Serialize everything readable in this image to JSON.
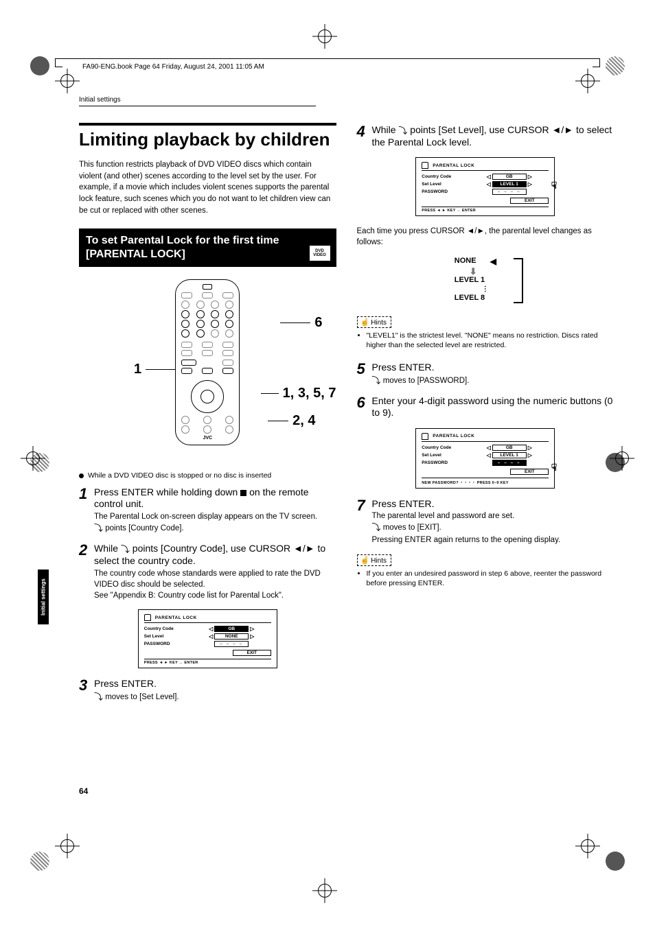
{
  "header_line": "FA90-ENG.book  Page 64  Friday, August 24, 2001  11:05 AM",
  "running_head": "Initial settings",
  "side_tab": "Initial settings",
  "page_number": "64",
  "title": "Limiting playback by children",
  "intro": "This function restricts playback of DVD VIDEO discs which contain violent (and other) scenes according to the level set by the user. For example, if a movie which includes violent scenes supports the parental lock feature, such scenes which you do not want to let children view can be cut or replaced with other scenes.",
  "subsection_title": "To set Parental Lock for the first time [PARENTAL LOCK]",
  "dvd_badge": {
    "line1": "DVD",
    "line2": "VIDEO"
  },
  "remote_logo": "JVC",
  "callouts": {
    "c6": "6",
    "c1": "1",
    "c1357": "1, 3, 5, 7",
    "c24": "2, 4"
  },
  "bullet": "While a DVD VIDEO disc is stopped or no disc is inserted",
  "steps": {
    "s1": {
      "num": "1",
      "head": "Press ENTER while holding down ■ on the remote control unit.",
      "body1": "The Parental Lock on-screen display appears on the TV screen.",
      "body2": " points [Country Code]."
    },
    "s2": {
      "num": "2",
      "head": "While   points [Country Code], use CURSOR ◄/► to select the country code.",
      "body1": "The country code whose standards were applied to rate the DVD VIDEO disc should be selected.",
      "body2": "See \"Appendix B: Country code list for Parental Lock\"."
    },
    "s3": {
      "num": "3",
      "head": "Press ENTER.",
      "body1": " moves to [Set Level]."
    },
    "s4": {
      "num": "4",
      "head": "While   points [Set Level], use CURSOR ◄/► to select the Parental Lock level."
    },
    "s4_after": "Each time you press CURSOR ◄/►, the parental level changes as follows:",
    "s5": {
      "num": "5",
      "head": "Press ENTER.",
      "body1": " moves to [PASSWORD]."
    },
    "s6": {
      "num": "6",
      "head": "Enter your 4-digit password using the numeric buttons (0 to 9)."
    },
    "s7": {
      "num": "7",
      "head": "Press ENTER.",
      "body1": "The parental level and password are set.",
      "body2": " moves to [EXIT].",
      "body3": "Pressing ENTER again returns to the opening display."
    }
  },
  "levels": {
    "none": "NONE",
    "l1": "LEVEL 1",
    "l8": "LEVEL 8"
  },
  "hints_label": "Hints",
  "hints1": "\"LEVEL1\" is the strictest level. \"NONE\" means no restriction. Discs rated higher than the selected level are restricted.",
  "hints2": "If you enter an undesired password in step 6 above, reenter the password before pressing ENTER.",
  "osd": {
    "title": "PARENTAL LOCK",
    "rows": {
      "country": "Country Code",
      "setlevel": "Set Level",
      "password": "PASSWORD"
    },
    "vals": {
      "gb": "GB",
      "none": "NONE",
      "level1": "LEVEL 1",
      "dashes": "– – – –"
    },
    "exit": "EXIT",
    "foot1": "PRESS ◄ ► KEY   →  ENTER",
    "foot2": "NEW PASSWORD? ・・・・ PRESS 0–9 KEY"
  }
}
